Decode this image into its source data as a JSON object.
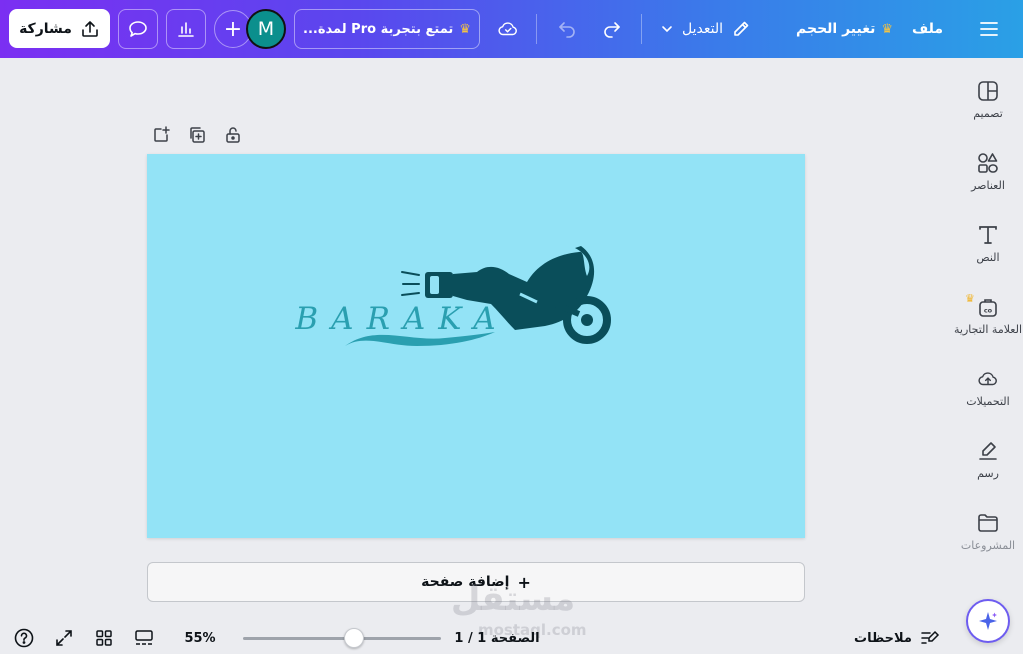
{
  "topbar": {
    "menu_icon": "hamburger-icon",
    "file_label": "ملف",
    "resize_label": "تغيير الحجم",
    "edit_label": "التعديل",
    "promo_label": "تمتع بتجربة Pro لمدة...",
    "avatar_letter": "M",
    "share_label": "مشاركة",
    "gradient_colors": [
      "#7b2ff2",
      "#2aa0e6"
    ]
  },
  "sidebar": {
    "items": [
      {
        "label": "تصميم",
        "icon": "layout-icon"
      },
      {
        "label": "العناصر",
        "icon": "shapes-icon"
      },
      {
        "label": "النص",
        "icon": "text-icon"
      },
      {
        "label": "العلامة التجارية",
        "icon": "brand-kit-icon"
      },
      {
        "label": "التحميلات",
        "icon": "cloud-upload-icon"
      },
      {
        "label": "رسم",
        "icon": "draw-icon"
      },
      {
        "label": "المشروعات",
        "icon": "folder-icon"
      }
    ]
  },
  "canvas": {
    "background_color": "#93e3f6",
    "logo_text": "BARAKA",
    "logo_color": "#0a4e5a",
    "add_page_label": "إضافة صفحة"
  },
  "bottombar": {
    "notes_label": "ملاحظات",
    "page_indicator": "الصفحة 1 / 1",
    "zoom_label": "55%",
    "zoom_level_percent": 55
  },
  "watermark": {
    "text": "مستقل",
    "sub": "mostaql.com"
  }
}
